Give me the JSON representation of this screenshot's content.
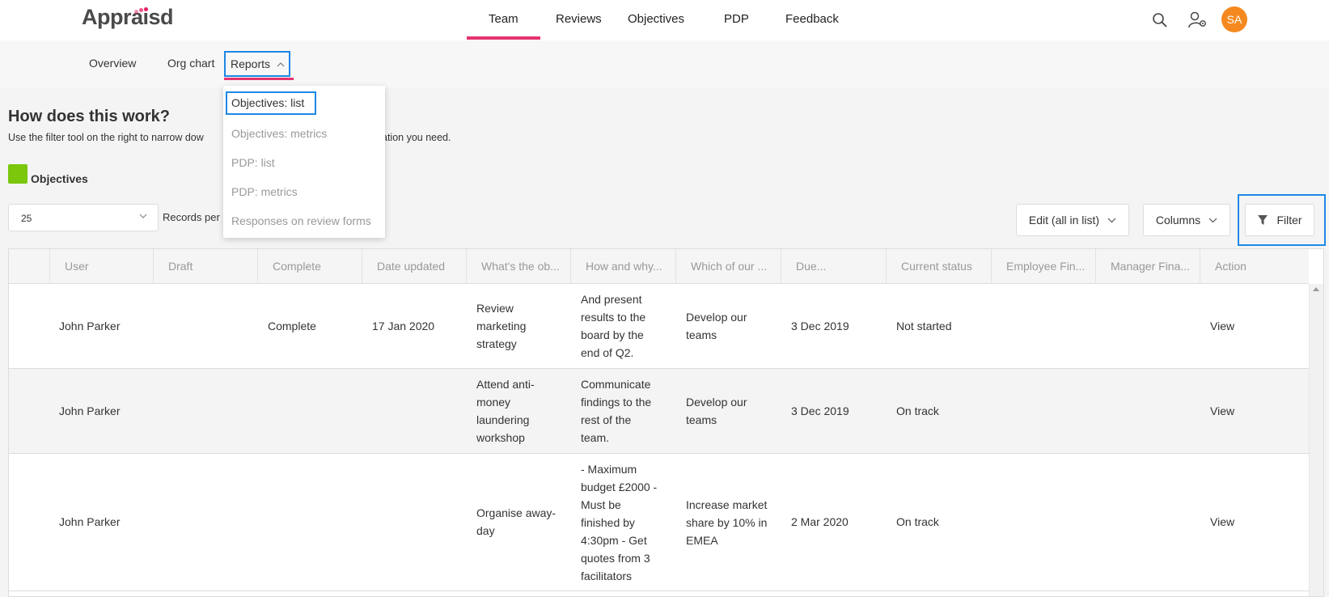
{
  "app": {
    "logo": "Appraisd"
  },
  "main_nav": {
    "tabs": [
      "Team",
      "Reviews",
      "Objectives",
      "PDP",
      "Feedback"
    ],
    "active": "Team"
  },
  "header_icons": [
    "search-icon",
    "user-settings-icon"
  ],
  "user": {
    "initials": "SA",
    "avatar_color": "#f5891f"
  },
  "sub_nav": {
    "items": [
      "Overview",
      "Org chart",
      "Reports"
    ],
    "active": "Reports"
  },
  "reports_menu": {
    "items": [
      "Objectives: list",
      "Objectives: metrics",
      "PDP: list",
      "PDP: metrics",
      "Responses on review forms"
    ],
    "selected": "Objectives: list"
  },
  "help": {
    "title": "How does this work?",
    "text_left": "Use the filter tool on the right to narrow dow",
    "text_right": "ation you need."
  },
  "section": {
    "label": "Objectives",
    "color": "#7ac70c"
  },
  "records": {
    "value": "25",
    "label": "Records per page"
  },
  "toolbar": {
    "edit_label": "Edit (all in list)",
    "columns_label": "Columns",
    "filter_label": "Filter"
  },
  "table": {
    "columns": [
      "User",
      "Draft",
      "Complete",
      "Date updated",
      "What's the ob...",
      "How and why...",
      "Which of our ...",
      "Due...",
      "Current status",
      "Employee Fin...",
      "Manager Fina...",
      "Action"
    ],
    "rows": [
      {
        "user": "John Parker",
        "draft": "",
        "complete": "Complete",
        "date_updated": "17 Jan 2020",
        "objective": [
          "Review",
          "marketing",
          "strategy"
        ],
        "how": [
          "And present",
          "results to the",
          "board by the",
          "end of Q2."
        ],
        "which": [
          "Develop our",
          "teams"
        ],
        "due": "3 Dec 2019",
        "status": "Not started",
        "action": "View"
      },
      {
        "user": "John Parker",
        "draft": "",
        "complete": "",
        "date_updated": "",
        "objective": [
          "Attend anti-",
          "money",
          "laundering",
          "workshop"
        ],
        "how": [
          "Communicate",
          "findings to the",
          "rest of the",
          "team."
        ],
        "which": [
          "Develop our",
          "teams"
        ],
        "due": "3 Dec 2019",
        "status": "On track",
        "action": "View"
      },
      {
        "user": "John Parker",
        "draft": "",
        "complete": "",
        "date_updated": "",
        "objective": [
          "Organise away-",
          "day"
        ],
        "how": [
          "- Maximum",
          "budget £2000 -",
          "Must be",
          "finished by",
          "4:30pm - Get",
          "quotes from 3",
          "facilitators"
        ],
        "which": [
          "Increase market",
          "share by 10% in",
          "EMEA"
        ],
        "due": "2 Mar 2020",
        "status": "On track",
        "action": "View"
      }
    ]
  }
}
